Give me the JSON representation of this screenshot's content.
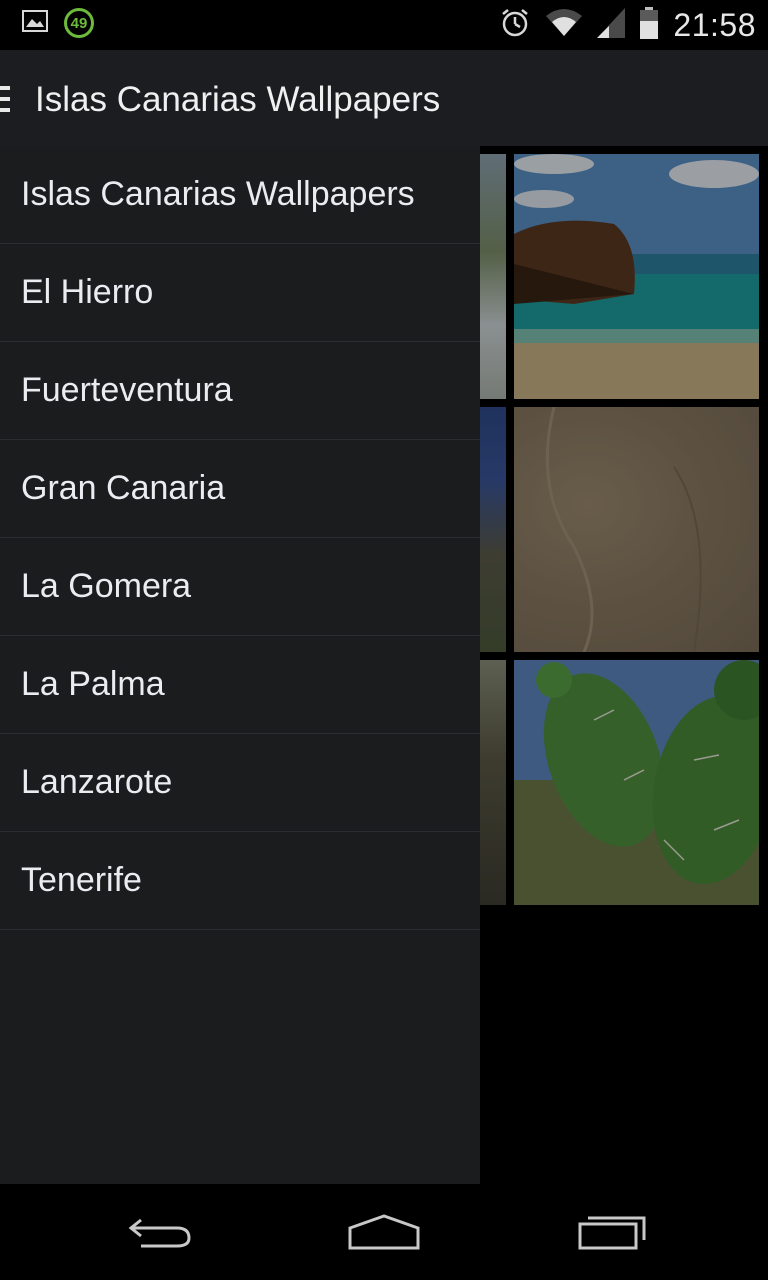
{
  "status_bar": {
    "notification_count": "49",
    "time": "21:58",
    "icons": [
      "image-icon",
      "battery-saver-icon",
      "alarm-icon",
      "wifi-icon",
      "signal-icon",
      "battery-icon"
    ]
  },
  "action_bar": {
    "title": "Islas Canarias Wallpapers",
    "menu_icon": "hamburger-icon"
  },
  "drawer": {
    "items": [
      {
        "label": "Islas Canarias Wallpapers"
      },
      {
        "label": "El Hierro"
      },
      {
        "label": "Fuerteventura"
      },
      {
        "label": "Gran Canaria"
      },
      {
        "label": "La Gomera"
      },
      {
        "label": "La Palma"
      },
      {
        "label": "Lanzarote"
      },
      {
        "label": "Tenerife"
      }
    ]
  },
  "gallery": {
    "thumbnails": [
      "beach-cliff-photo",
      "sand-dune-photo",
      "cactus-photo"
    ]
  },
  "nav_bar": {
    "buttons": [
      "back-icon",
      "home-icon",
      "recents-icon"
    ]
  },
  "colors": {
    "drawer_bg": "#1b1c1e",
    "action_bar_bg": "#1c1d20",
    "divider": "#2c2d30",
    "accent_green": "#6dbb3a"
  }
}
